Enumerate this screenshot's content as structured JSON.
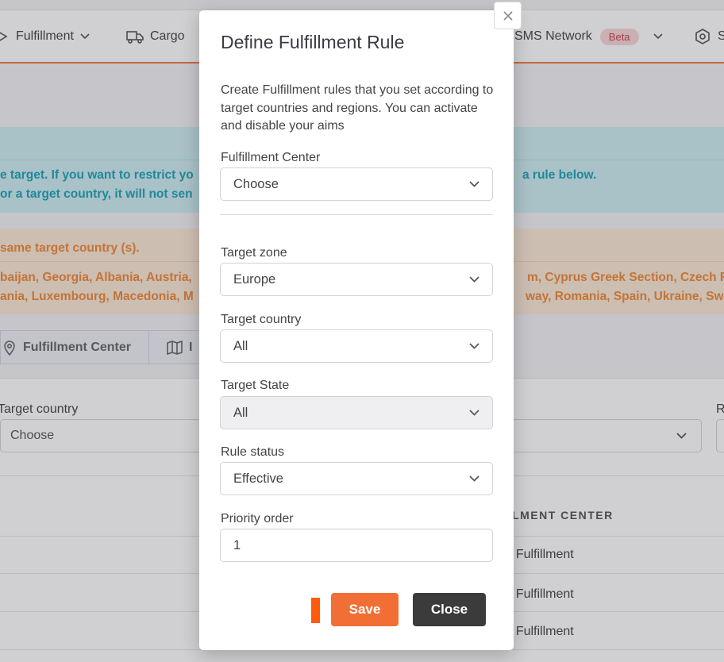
{
  "nav": {
    "items": [
      {
        "label": "Fulfillment"
      },
      {
        "label": "Cargo"
      },
      {
        "label": "SMS Network",
        "badge": "Beta"
      },
      {
        "label": "S"
      }
    ]
  },
  "info_teal": {
    "line1a": "e target. If you want to restrict yo",
    "line1b": "a rule below.",
    "line2": "or a target country, it will not sen"
  },
  "info_orange": {
    "line0": "same target country (s).",
    "line1a": "baijan, Georgia, Albania, Austria,",
    "line1b": "m, Cyprus Greek Section, Czech Re",
    "line2a": "ania, Luxembourg, Macedonia, M",
    "line2b": "way, Romania, Spain, Ukraine, Swed"
  },
  "tabs": [
    {
      "label": "Fulfillment Center"
    },
    {
      "label": "I"
    }
  ],
  "filters": {
    "target_country_label": "Target country",
    "target_country_value": "Choose",
    "right_label": "R"
  },
  "table": {
    "header": "LLMENT CENTER",
    "rows": [
      "P Fulfillment",
      "P Fulfillment",
      "P Fulfillment"
    ]
  },
  "modal": {
    "title": "Define Fulfillment Rule",
    "description": "Create Fulfillment rules that you set according to target countries and regions. You can activate and disable your aims",
    "fulfillment_center": {
      "label": "Fulfillment Center",
      "value": "Choose"
    },
    "target_zone": {
      "label": "Target zone",
      "value": "Europe"
    },
    "target_country": {
      "label": "Target country",
      "value": "All"
    },
    "target_state": {
      "label": "Target State",
      "value": "All"
    },
    "rule_status": {
      "label": "Rule status",
      "value": "Effective"
    },
    "priority_order": {
      "label": "Priority order",
      "value": "1"
    },
    "save_label": "Save",
    "close_label": "Close"
  },
  "colors": {
    "accent": "#f16f35",
    "dark_button": "#3b3b3b",
    "teal_text": "#1fa3b8",
    "orange_text": "#ef8a3a"
  }
}
